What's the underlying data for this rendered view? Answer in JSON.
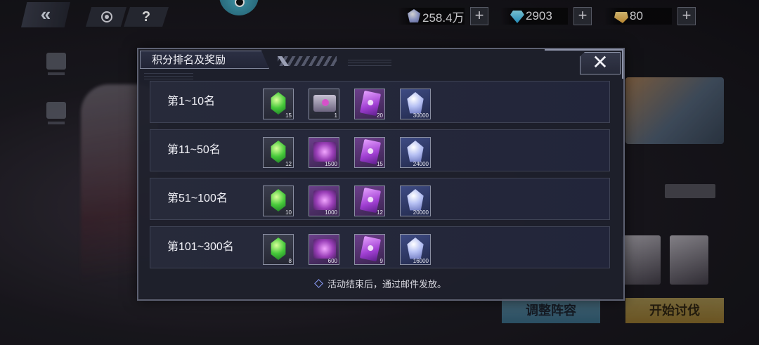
{
  "topbar": {
    "currencies": [
      {
        "icon": "crystal-icon",
        "value": "258.4万"
      },
      {
        "icon": "diamond-icon",
        "value": "2903"
      },
      {
        "icon": "gold-ticket-icon",
        "value": "80"
      }
    ],
    "plus": "+",
    "help": "?"
  },
  "background": {
    "adjust_button": "调整阵容",
    "start_button": "开始讨伐"
  },
  "modal": {
    "title": "积分排名及奖励",
    "close": "✕",
    "rows": [
      {
        "rank": "第1~10名",
        "rewards": [
          {
            "icon": "emerald-icon",
            "qty": "15"
          },
          {
            "icon": "supply-box-icon",
            "qty": "1"
          },
          {
            "icon": "purple-card-icon",
            "qty": "20"
          },
          {
            "icon": "crystal-icon",
            "qty": "30000"
          }
        ]
      },
      {
        "rank": "第11~50名",
        "rewards": [
          {
            "icon": "emerald-icon",
            "qty": "12"
          },
          {
            "icon": "purple-chip-icon",
            "qty": "1500"
          },
          {
            "icon": "purple-card-icon",
            "qty": "15"
          },
          {
            "icon": "crystal-icon",
            "qty": "24000"
          }
        ]
      },
      {
        "rank": "第51~100名",
        "rewards": [
          {
            "icon": "emerald-icon",
            "qty": "10"
          },
          {
            "icon": "purple-chip-icon",
            "qty": "1000"
          },
          {
            "icon": "purple-card-icon",
            "qty": "12"
          },
          {
            "icon": "crystal-icon",
            "qty": "20000"
          }
        ]
      },
      {
        "rank": "第101~300名",
        "rewards": [
          {
            "icon": "emerald-icon",
            "qty": "8"
          },
          {
            "icon": "purple-chip-icon",
            "qty": "600"
          },
          {
            "icon": "purple-card-icon",
            "qty": "9"
          },
          {
            "icon": "crystal-icon",
            "qty": "16000"
          }
        ]
      }
    ],
    "footer": "活动结束后，通过邮件发放。"
  },
  "colors": {
    "accent": "#8ea0ff",
    "panel": "#1e202c",
    "border": "#5d6172"
  }
}
